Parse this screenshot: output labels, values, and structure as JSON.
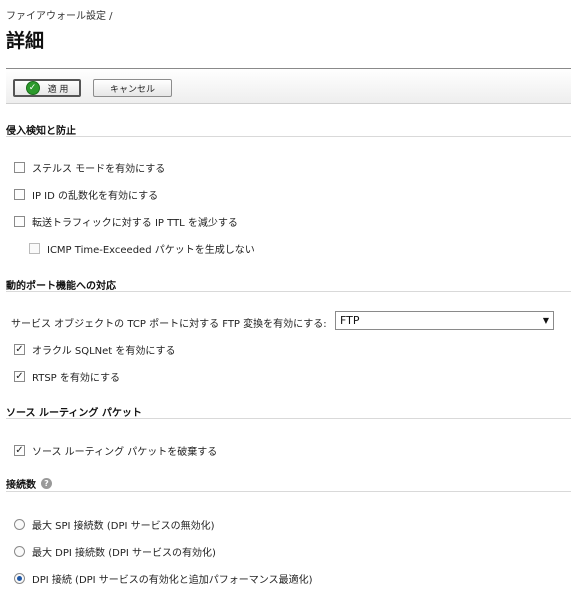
{
  "header": {
    "breadcrumb": "ファイアウォール設定 /",
    "title": "詳細"
  },
  "toolbar": {
    "apply_label": "適 用",
    "cancel_label": "キャンセル"
  },
  "sections": {
    "intrusion": {
      "title": "侵入検知と防止",
      "stealth": {
        "label": "ステルス モードを有効にする",
        "checked": false
      },
      "ipid": {
        "label": "IP ID の乱数化を有効にする",
        "checked": false
      },
      "ttl": {
        "label": "転送トラフィックに対する IP TTL を減少する",
        "checked": false
      },
      "icmp": {
        "label": "ICMP Time-Exceeded パケットを生成しない",
        "checked": false,
        "disabled": true
      }
    },
    "dynamic_port": {
      "title": "動的ポート機能への対応",
      "ftp_label": "サービス オブジェクトの TCP ポートに対する FTP 変換を有効にする:",
      "ftp_value": "FTP",
      "sqlnet": {
        "label": "オラクル SQLNet を有効にする",
        "checked": true
      },
      "rtsp": {
        "label": "RTSP を有効にする",
        "checked": true
      }
    },
    "source_routing": {
      "title": "ソース ルーティング パケット",
      "drop": {
        "label": "ソース ルーティング パケットを破棄する",
        "checked": true
      }
    },
    "connections": {
      "title": "接続数",
      "help": "?",
      "options": [
        {
          "label": "最大 SPI 接続数 (DPI サービスの無効化)",
          "selected": false
        },
        {
          "label": "最大 DPI 接続数 (DPI サービスの有効化)",
          "selected": false
        },
        {
          "label": "DPI 接続 (DPI サービスの有効化と追加パフォーマンス最適化)",
          "selected": true
        }
      ]
    }
  },
  "colors": {
    "radio_selected": "#1f57a6",
    "apply_icon": "#2c9a2c"
  },
  "icons": {
    "apply": "check-circle-icon",
    "select": "dropdown-arrow-icon",
    "help": "help-icon"
  }
}
